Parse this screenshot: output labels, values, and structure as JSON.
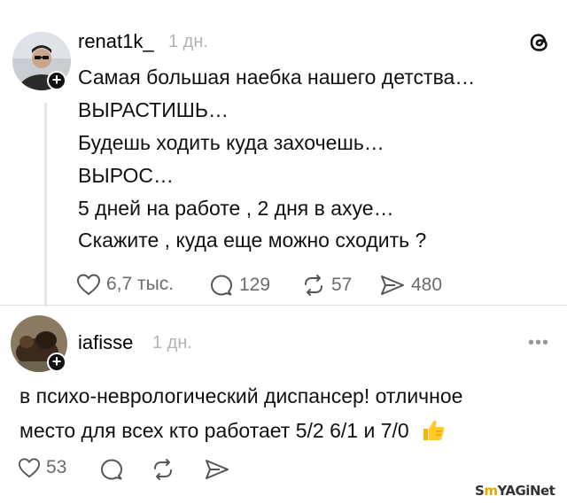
{
  "post": {
    "username": "renat1k_",
    "time": "1 дн.",
    "lines": [
      "Самая большая наебка нашего детства…",
      "ВЫРАСТИШЬ…",
      "Будешь ходить куда захочешь…",
      "ВЫРОС…",
      "5 дней на работе , 2 дня в ахуе…",
      "Скажите , куда еще можно сходить ?"
    ],
    "likes": "6,7 тыс.",
    "comments": "129",
    "reposts": "57",
    "shares": "480"
  },
  "reply": {
    "username": "iafisse",
    "time": "1 дн.",
    "lines": [
      "в психо-неврологический диспансер! отличное",
      "место для всех кто работает 5/2 6/1 и 7/0"
    ],
    "emoji": "👍",
    "likes": "53"
  },
  "watermark": {
    "text_a": "S",
    "text_b": "m",
    "text_c": "YAGiNet"
  },
  "icons": {
    "threads_logo": "threads-logo-icon",
    "like": "heart-icon",
    "comment": "comment-bubble-icon",
    "repost": "repost-icon",
    "share": "send-icon",
    "more": "more-dots-icon"
  },
  "colors": {
    "text": "#111111",
    "muted": "#6b6b6b",
    "time": "#b3b3b3",
    "thumb": "#f4b400"
  }
}
